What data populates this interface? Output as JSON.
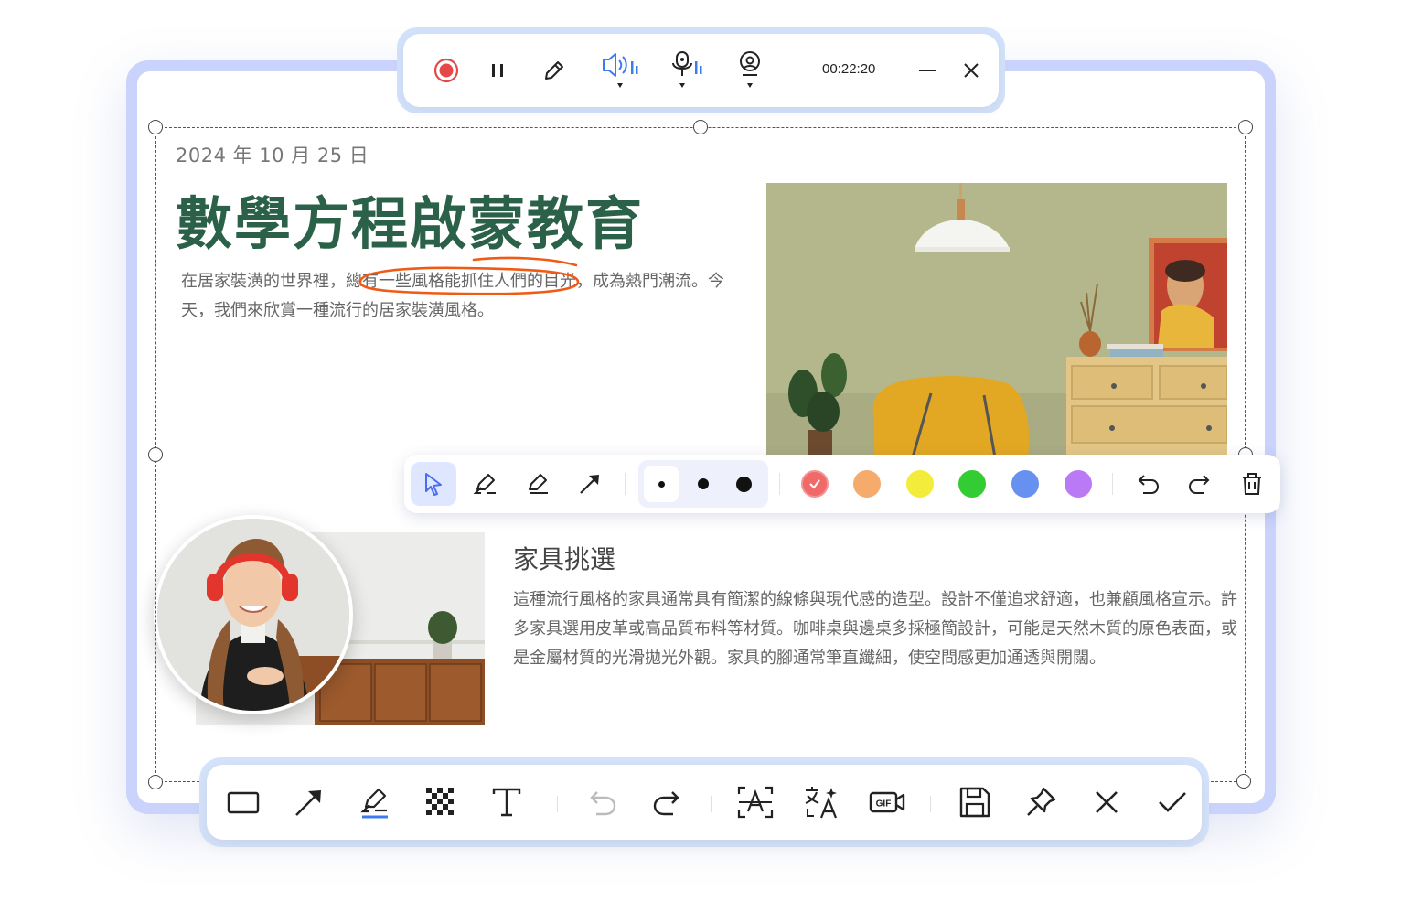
{
  "recording_toolbar": {
    "timer": "00:22:20",
    "buttons": [
      "record-button",
      "pause-button",
      "pen-button",
      "speaker-button",
      "microphone-button",
      "webcam-button",
      "minimize-button",
      "close-button"
    ]
  },
  "article": {
    "date": "2024 年 10 月 25 日",
    "title": "數學方程啟蒙教育",
    "intro": "在居家裝潢的世界裡，總有一些風格能抓住人們的目光，成為熱門潮流。今天，我們來欣賞一種流行的居家裝潢風格。",
    "section_title": "家具挑選",
    "section_body": "這種流行風格的家具通常具有簡潔的線條與現代感的造型。設計不僅追求舒適，也兼顧風格宣示。許多家具選用皮革或高品質布料等材質。咖啡桌與邊桌多採極簡設計，可能是天然木質的原色表面，或是金屬材質的光滑拋光外觀。家具的腳通常筆直纖細，使空間感更加通透與開闊。"
  },
  "annotation_toolbar": {
    "tools": [
      "select-tool",
      "highlighter-tool",
      "marker-tool",
      "arrow-tool"
    ],
    "brush_sizes": [
      "small",
      "medium",
      "large"
    ],
    "selected_size": "small",
    "colors": [
      "#f06a6a",
      "#f5ab6c",
      "#f3ec3a",
      "#33cc33",
      "#6691f0",
      "#bb7af5"
    ],
    "selected_color": "#f06a6a"
  },
  "bottom_toolbar": {
    "tools": [
      "rectangle",
      "arrow",
      "highlighter",
      "mosaic",
      "text",
      "undo",
      "redo",
      "ocr",
      "translate",
      "gif-record",
      "save",
      "pin",
      "cancel",
      "confirm"
    ]
  },
  "colors": {
    "accent": "#2a6148",
    "frame": "#c9d3fb",
    "ink": "#f05a14",
    "record": "#e54848",
    "audio_blue": "#3c7cf0"
  }
}
